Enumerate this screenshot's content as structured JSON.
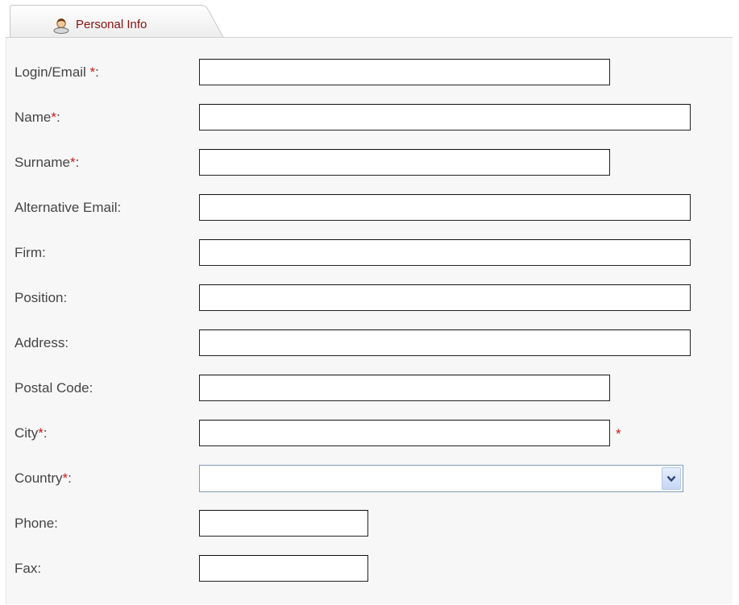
{
  "tab": {
    "label": "Personal Info",
    "icon": "user-icon"
  },
  "form": {
    "fields": [
      {
        "key": "login_email",
        "label": "Login/Email",
        "required_mark": " *",
        "suffix": ":",
        "value": ""
      },
      {
        "key": "name",
        "label": "Name",
        "required_mark": "*",
        "suffix": ":",
        "value": ""
      },
      {
        "key": "surname",
        "label": "Surname",
        "required_mark": "*",
        "suffix": ":",
        "value": ""
      },
      {
        "key": "alt_email",
        "label": "Alternative Email:",
        "value": ""
      },
      {
        "key": "firm",
        "label": "Firm:",
        "value": ""
      },
      {
        "key": "position",
        "label": "Position:",
        "value": ""
      },
      {
        "key": "address",
        "label": "Address:",
        "value": ""
      },
      {
        "key": "postal_code",
        "label": "Postal Code:",
        "value": ""
      },
      {
        "key": "city",
        "label": "City",
        "required_mark": "*",
        "suffix": ":",
        "value": "",
        "trailing_mark": "*"
      },
      {
        "key": "country",
        "label": "Country",
        "required_mark": "*",
        "suffix": ":",
        "selected": "",
        "icon": "chevron-down-icon"
      },
      {
        "key": "phone",
        "label": "Phone:",
        "value": ""
      },
      {
        "key": "fax",
        "label": "Fax:",
        "value": ""
      }
    ]
  },
  "colors": {
    "tab_label": "#8b1010",
    "required_star": "#cc1a1a",
    "panel_background": "#f7f7f7",
    "label_text": "#444444",
    "select_border": "#7f9db9"
  }
}
